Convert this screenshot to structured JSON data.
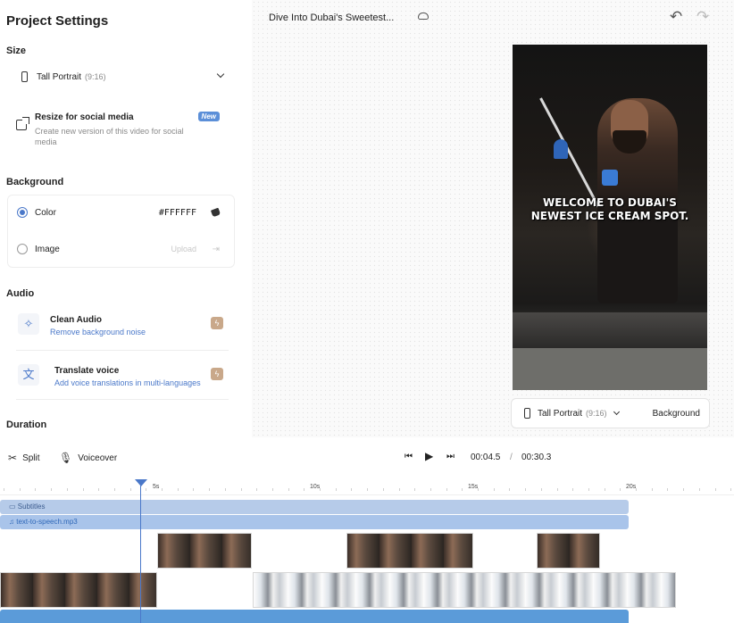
{
  "panel": {
    "title": "Project Settings",
    "size": {
      "label": "Size",
      "selected": "Tall Portrait",
      "ratio": "(9:16)"
    },
    "resize": {
      "title": "Resize for social media",
      "description": "Create new version of this video for social media",
      "badge": "New"
    },
    "background": {
      "label": "Background",
      "color_label": "Color",
      "color_value": "#FFFFFF",
      "image_label": "Image",
      "upload_label": "Upload"
    },
    "audio": {
      "label": "Audio",
      "items": [
        {
          "title": "Clean Audio",
          "description": "Remove background noise"
        },
        {
          "title": "Translate voice",
          "description": "Add voice translations in multi-languages"
        }
      ]
    },
    "duration": {
      "label": "Duration"
    }
  },
  "canvas": {
    "project_name": "Dive Into Dubai's Sweetest...",
    "caption": "WELCOME TO DUBAI'S NEWEST ICE CREAM SPOT.",
    "format": {
      "name": "Tall Portrait",
      "ratio": "(9:16)",
      "background_label": "Background"
    }
  },
  "controls": {
    "split_label": "Split",
    "voiceover_label": "Voiceover",
    "current_time": "00:04.5",
    "separator": "/",
    "total_time": "00:30.3"
  },
  "timeline": {
    "ticks": [
      "5s",
      "10s",
      "15s",
      "20s"
    ],
    "subtitle_track": "Subtitles",
    "tts_track": "text-to-speech.mp3",
    "playhead_seconds": 4.5
  },
  "colors": {
    "accent": "#4A78C9",
    "badge": "#5B8FD8",
    "premium": "#C9A88A"
  }
}
